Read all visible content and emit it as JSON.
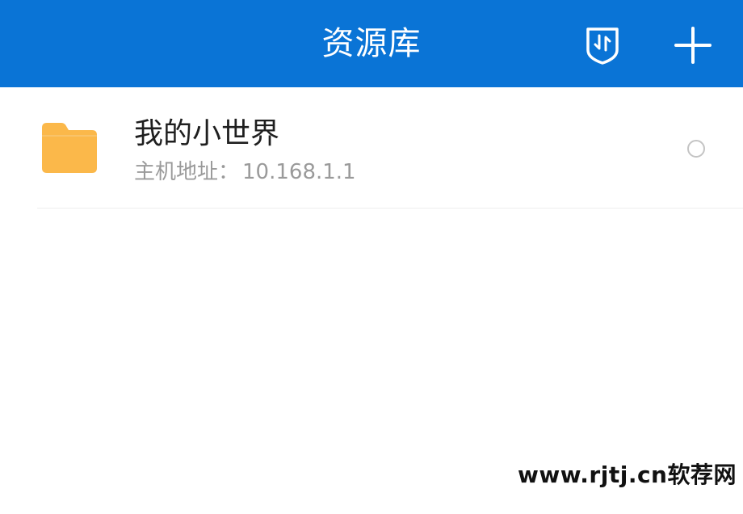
{
  "header": {
    "title": "资源库",
    "transfer_icon": "transfer-shield-icon",
    "add_icon": "plus-icon",
    "background_color": "#0a74d6"
  },
  "items": [
    {
      "title": "我的小世界",
      "host_label": "主机地址：",
      "host_value": "10.168.1.1",
      "icon": "folder-icon",
      "folder_color": "#fbb84a",
      "selected": false
    }
  ],
  "watermark": "www.rjtj.cn软荐网"
}
